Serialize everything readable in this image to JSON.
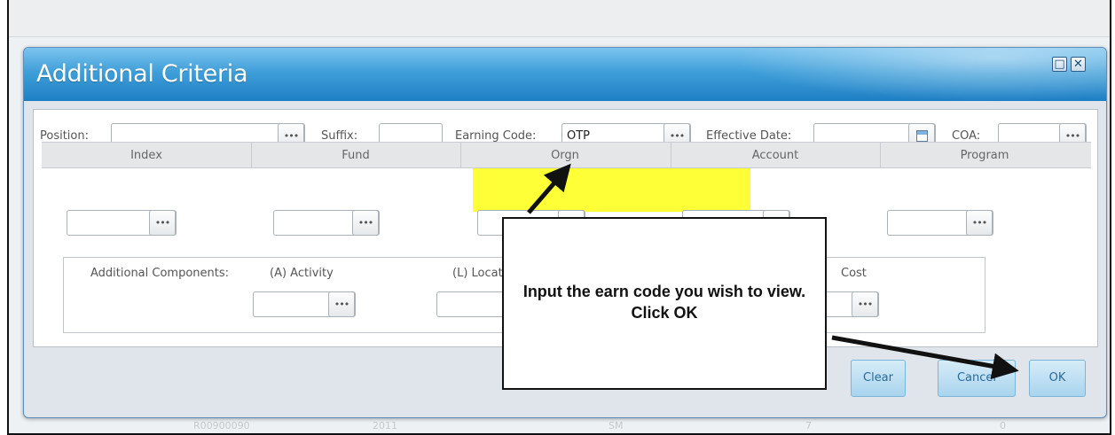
{
  "dialog": {
    "title": "Additional Criteria"
  },
  "criteria": {
    "position_label": "Position:",
    "position_value": "",
    "suffix_label": "Suffix:",
    "suffix_value": "",
    "earning_code_label": "Earning Code:",
    "earning_code_value": "OTP",
    "effective_date_label": "Effective Date:",
    "effective_date_value": "",
    "coa_label": "COA:",
    "coa_value": ""
  },
  "grid": {
    "columns": [
      "Index",
      "Fund",
      "Orgn",
      "Account",
      "Program"
    ]
  },
  "components": {
    "label": "Additional Components:",
    "activity_label": "(A) Activity",
    "location_label": "(L) Location",
    "cost_label": "Cost"
  },
  "buttons": {
    "clear": "Clear",
    "cancel": "Cancel",
    "ok": "OK"
  },
  "annotation": {
    "text": "Input the earn code you wish to view.  Click OK"
  },
  "background_row": [
    "R00900090",
    "2011",
    "SM",
    "7",
    "0"
  ],
  "colors": {
    "title_bar": "#3f9fd9",
    "highlight": "#ffff00",
    "button": "#a9d4ee"
  }
}
